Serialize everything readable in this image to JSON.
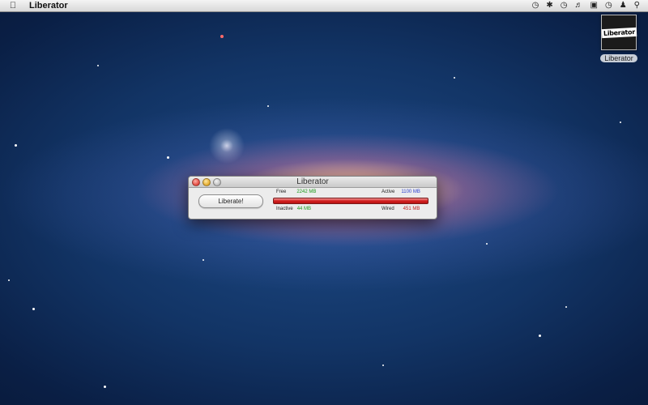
{
  "menubar": {
    "app_name": "Liberator",
    "apple_icon": "apple-icon",
    "status_icons": [
      "time-machine-icon",
      "bluetooth-icon",
      "wifi-icon",
      "volume-icon",
      "display-icon",
      "clock-icon",
      "user-icon",
      "spotlight-icon"
    ]
  },
  "desktop": {
    "icon_label": "Liberator",
    "icon_logo_text": "Liberator"
  },
  "window": {
    "title": "Liberator",
    "button_label": "Liberate!",
    "stats": {
      "free_label": "Free",
      "free_value": "2242 MB",
      "active_label": "Active",
      "active_value": "1100 MB",
      "inactive_label": "Inactive",
      "inactive_value": "44 MB",
      "wired_label": "Wired",
      "wired_value": "451 MB"
    },
    "colors": {
      "free": "#1a9a1a",
      "active": "#2a3fd0",
      "inactive": "#1a9a1a",
      "wired": "#c02020",
      "bar": "#d32020"
    }
  }
}
